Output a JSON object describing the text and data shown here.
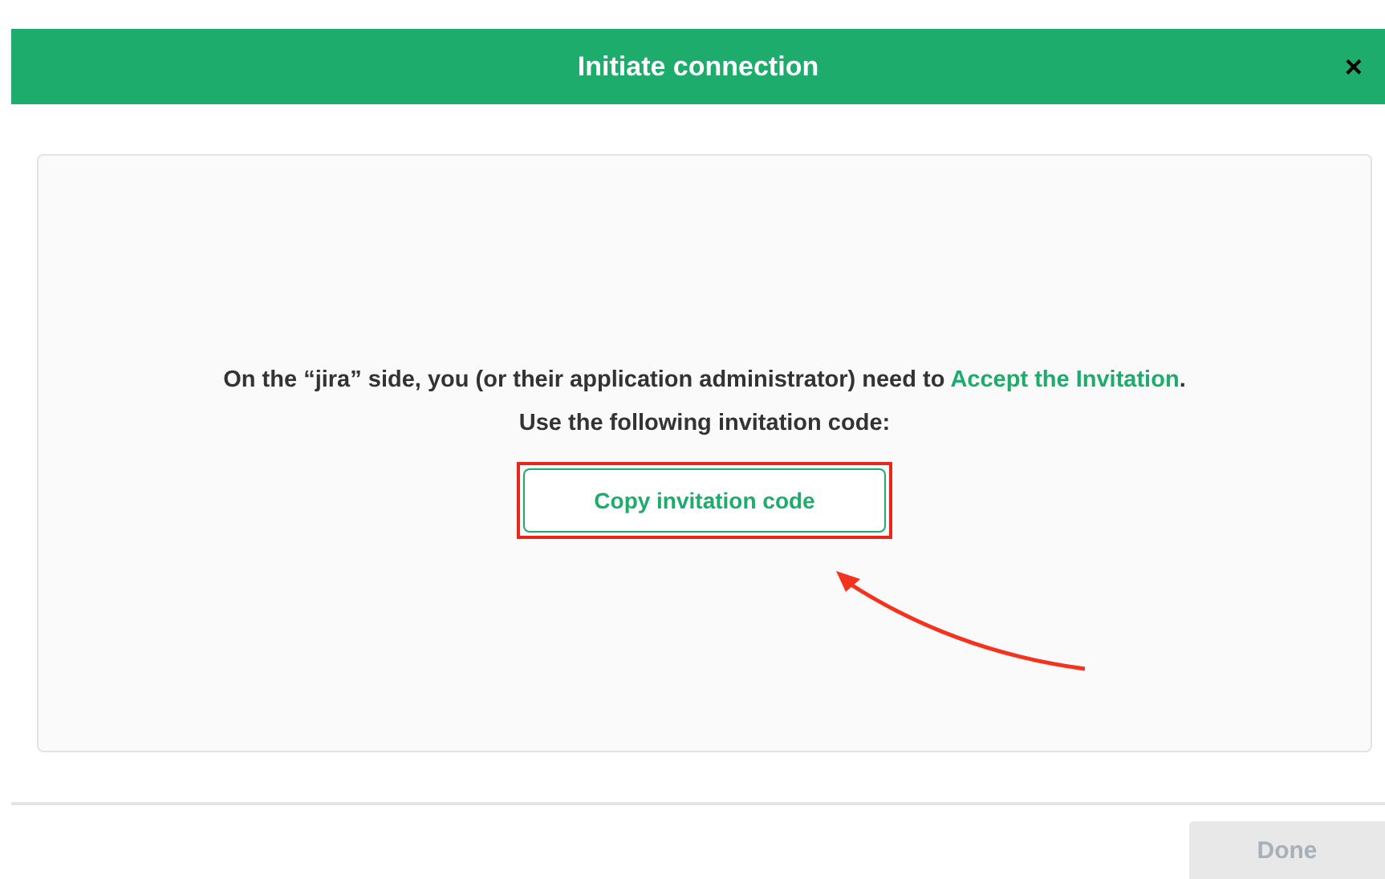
{
  "dialog": {
    "title": "Initiate connection",
    "close": "×"
  },
  "message": {
    "text": "On the “jira” side, you (or their application administrator) need to ",
    "link": "Accept the Invitation",
    "end": "."
  },
  "instruction": "Use the following invitation code:",
  "copy_button": {
    "label": "Copy invitation code"
  },
  "done_button": {
    "label": "Done",
    "disabled": true
  }
}
